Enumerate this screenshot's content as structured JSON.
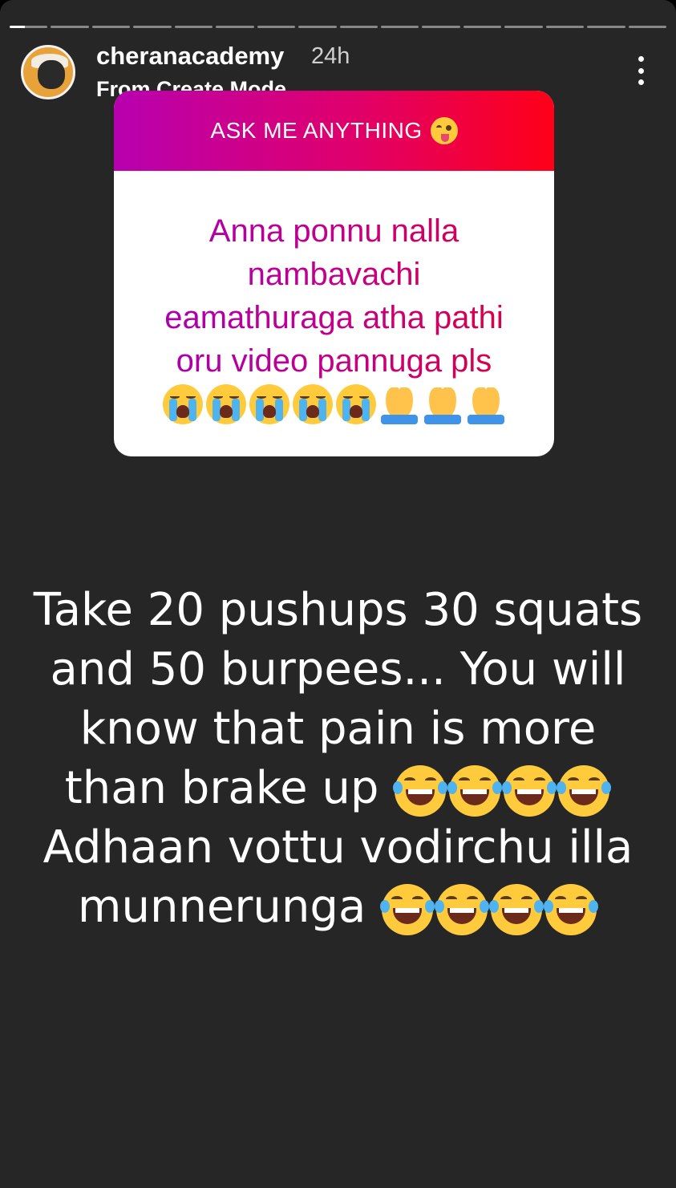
{
  "story": {
    "progress_segments": 16,
    "current_segment": 1
  },
  "header": {
    "username": "cheranacademy",
    "time": "24h",
    "subtitle": "From Create Mode",
    "avatar_icon": "profile-avatar",
    "more_icon": "more-vertical-icon"
  },
  "question_card": {
    "title": "ASK ME ANYTHING",
    "title_emoji": "winking-face-with-tongue",
    "question_lines": [
      "Anna ponnu nalla",
      "nambavachi",
      "eamathuraga atha pathi",
      "oru video pannuga pls"
    ],
    "emoji_row": [
      "loudly-crying-face",
      "loudly-crying-face",
      "loudly-crying-face",
      "loudly-crying-face",
      "loudly-crying-face",
      "folded-hands",
      "folded-hands",
      "folded-hands"
    ],
    "gradient_colors": [
      "#b800b0",
      "#e0006a",
      "#ff0018"
    ]
  },
  "answer": {
    "line1": "Take 20 pushups 30 squats",
    "line2": "and 50 burpees... You will",
    "line3": "know that pain is more",
    "line4": "than brake up",
    "line5": "Adhaan vottu vodirchu illa",
    "line6": "munnerunga",
    "laugh_emoji": "face-with-tears-of-joy"
  },
  "colors": {
    "background": "#262626",
    "text": "#ffffff"
  }
}
